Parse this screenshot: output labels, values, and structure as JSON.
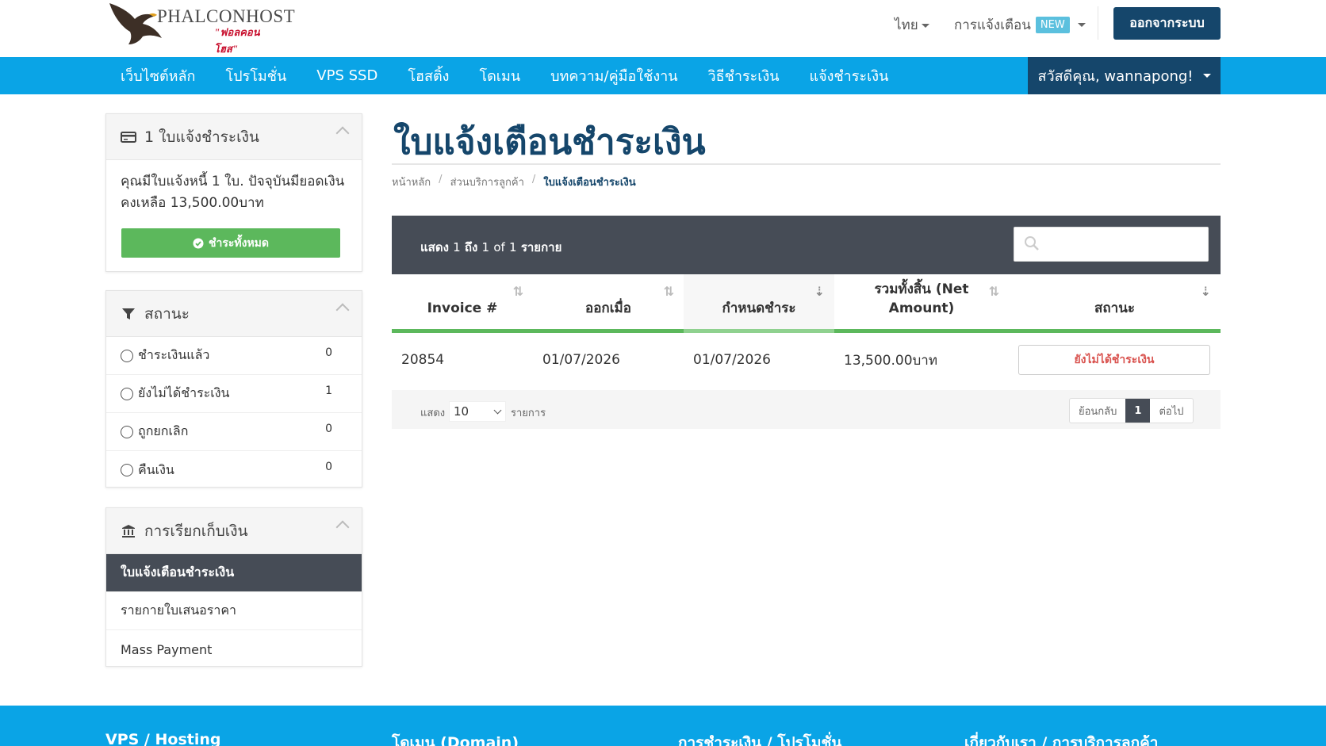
{
  "brand": {
    "name": "PHALCONHOST",
    "tagline": "\"ฟอลคอนโฮส\""
  },
  "header": {
    "lang": "ไทย",
    "notifications": "การแจ้งเตือน",
    "new_badge": "NEW",
    "logout": "ออกจากระบบ"
  },
  "nav": {
    "items": [
      "เว็บไซต์หลัก",
      "โปรโมชั่น",
      "VPS SSD",
      "โฮสติ้ง",
      "โดเมน",
      "บทความ/คู่มือใช้งาน",
      "วิธีชำระเงิน",
      "แจ้งชำระเงิน"
    ],
    "user": "สวัสดีคุณ, wannapong!"
  },
  "sidebar": {
    "invoices_panel": {
      "title": "1 ใบแจ้งชำระเงิน",
      "message": "คุณมีใบแจ้งหนี้ 1 ใบ. ปัจจุบันมียอดเงินคงเหลือ 13,500.00บาท",
      "pay_all": "ชำระทั้งหมด"
    },
    "status_panel": {
      "title": "สถานะ",
      "filters": [
        {
          "label": "ชำระเงินแล้ว",
          "count": "0"
        },
        {
          "label": "ยังไม่ได้ชำระเงิน",
          "count": "1"
        },
        {
          "label": "ถูกยกเลิก",
          "count": "0"
        },
        {
          "label": "คืนเงิน",
          "count": "0"
        }
      ]
    },
    "billing_panel": {
      "title": "การเรียกเก็บเงิน",
      "items": [
        "ใบแจ้งเตือนชำระเงิน",
        "รายกายใบเสนอราคา",
        "Mass Payment"
      ]
    }
  },
  "main": {
    "title": "ใบแจ้งเตือนชำระเงิน",
    "breadcrumb": [
      "หน้าหลัก",
      "ส่วนบริการลูกค้า",
      "ใบแจ้งเตือนชำระเงิน"
    ],
    "table_info": {
      "show": "แสดง",
      "from": "1",
      "to_word": "ถึง",
      "to": "1",
      "of": "of",
      "total": "1",
      "unit": "รายกาย"
    },
    "columns": [
      "Invoice #",
      "ออกเมื่อ",
      "กำหนดชำระ",
      "รวมทั้งสิ้น (Net Amount)",
      "สถานะ"
    ],
    "rows": [
      {
        "invoice": "20854",
        "issued": "01/07/2026",
        "due": "01/07/2026",
        "total": "13,500.00บาท",
        "status": "ยังไม่ได้ชำระเงิน"
      }
    ],
    "footer": {
      "show": "แสดง",
      "per_page": "10",
      "items": "รายการ",
      "prev": "ย้อนกลับ",
      "page": "1",
      "next": "ต่อไป"
    }
  },
  "site_footer": {
    "cols": [
      "VPS / Hosting",
      "โดเมน (Domain)",
      "การชำระเงิน / โปรโมชั่น",
      "เกี่ยวกับเรา / การบริการลูกค้า"
    ]
  },
  "colors": {
    "nav_blue": "#0aa4e6",
    "dark_blue": "#15466b",
    "slate": "#464c56",
    "green": "#5cb85c",
    "unpaid_red": "#d9534f"
  }
}
